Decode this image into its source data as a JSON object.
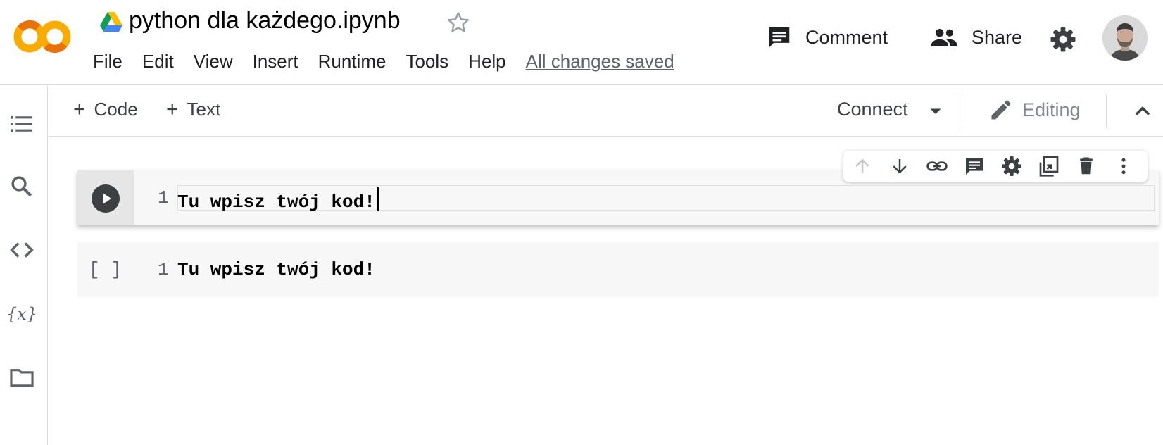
{
  "header": {
    "doc_title": "python dla każdego.ipynb",
    "menu": [
      "File",
      "Edit",
      "View",
      "Insert",
      "Runtime",
      "Tools",
      "Help"
    ],
    "saved_status": "All changes saved",
    "comment_label": "Comment",
    "share_label": "Share"
  },
  "toolbar": {
    "add_code_label": "Code",
    "add_text_label": "Text",
    "connect_label": "Connect",
    "editing_label": "Editing"
  },
  "cells": [
    {
      "line_number": "1",
      "code": "Tu wpisz twój kod!",
      "status": "run-button"
    },
    {
      "line_number": "1",
      "code": "Tu wpisz twój kod!",
      "exec_count": "[ ]"
    }
  ],
  "icons": {
    "rail": [
      "table-of-contents-icon",
      "search-icon",
      "code-snippets-icon",
      "variables-icon",
      "files-folder-icon"
    ],
    "cell_toolbar": [
      "move-up-icon",
      "move-down-icon",
      "link-icon",
      "comment-icon",
      "cell-settings-icon",
      "mirror-cell-icon",
      "delete-icon",
      "more-vert-icon"
    ]
  },
  "colors": {
    "logo_orange": "#F9AB00",
    "logo_dark_orange": "#E8710A",
    "text_primary": "#202124",
    "text_muted": "#5f6368",
    "cell_background": "#f7f7f7"
  }
}
